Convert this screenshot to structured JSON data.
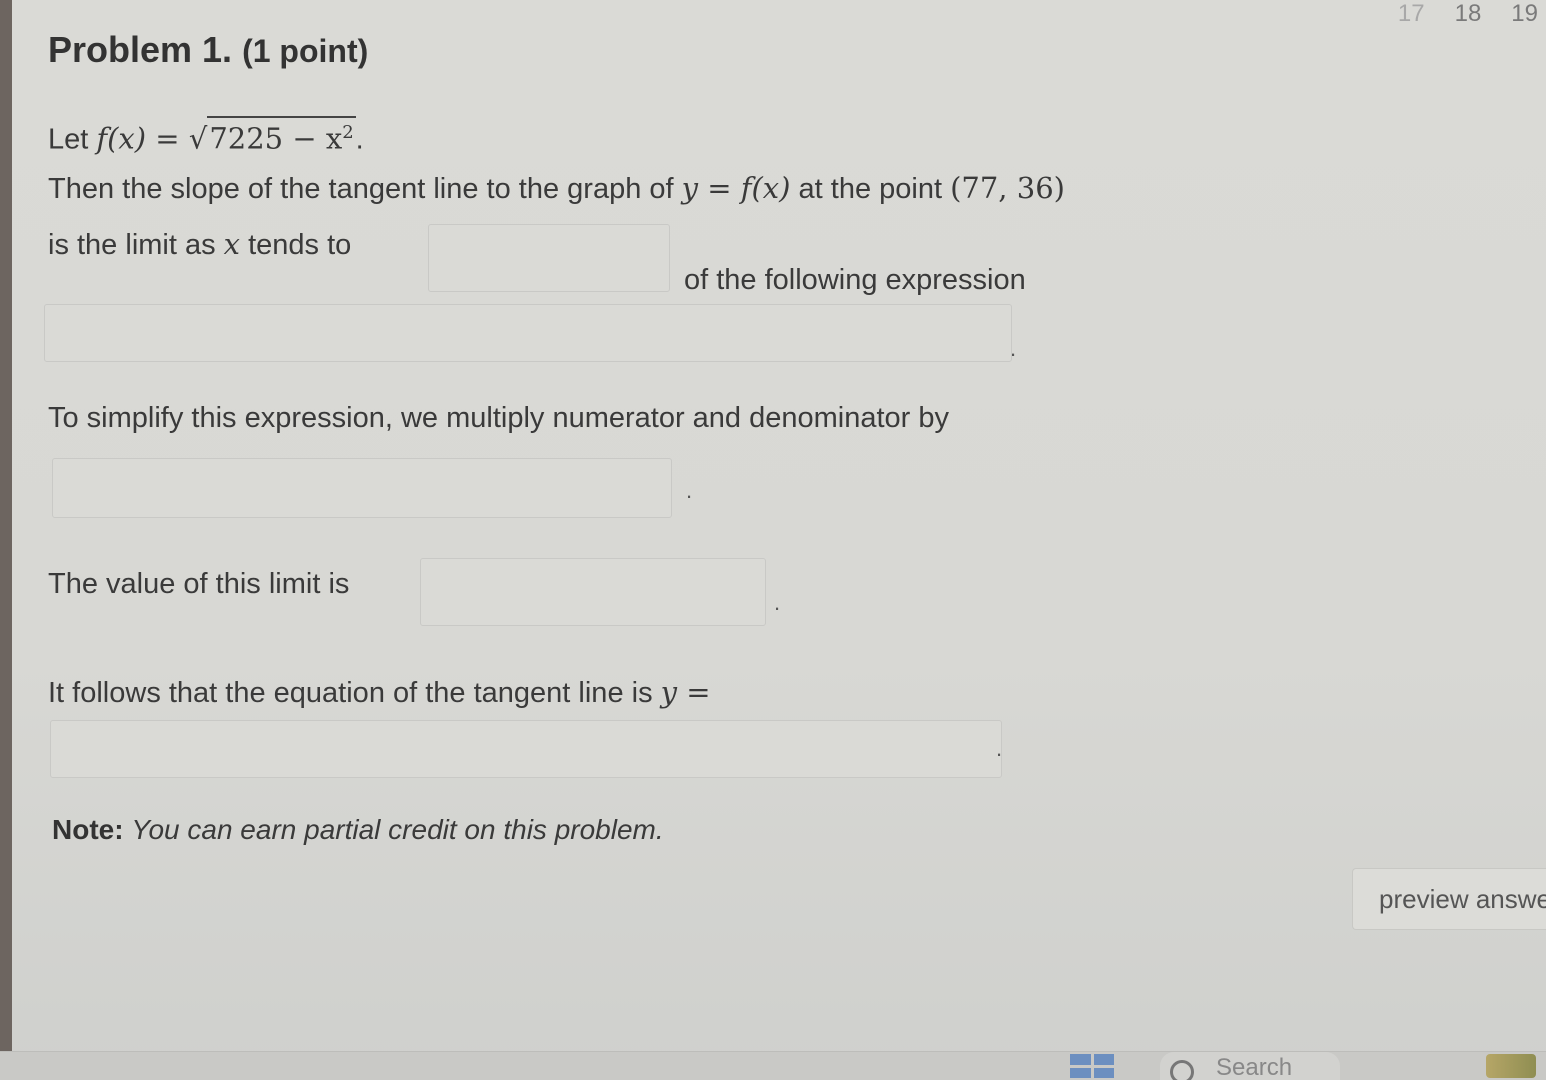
{
  "tabs": [
    {
      "label": "17",
      "faded": true
    },
    {
      "label": "18",
      "faded": false
    },
    {
      "label": "19",
      "faded": false
    }
  ],
  "problem": {
    "title": "Problem 1.",
    "points": "(1 point)",
    "let_prefix": "Let ",
    "function_def": "f(x) = ",
    "radicand": "7225 − x",
    "radicand_exp": "2",
    "period": ".",
    "line2_text": "Then the slope of the tangent line to the graph of ",
    "line2_math": "y = f(x)",
    "line2_text_b": " at the point ",
    "line2_point": "(77, 36)",
    "line3_a": "is the limit as ",
    "line3_var": "x",
    "line3_b": " tends to",
    "line3_c": "of the following expression",
    "simplify_text": "To simplify this expression, we multiply numerator and denominator by",
    "limit_value_text": "The value of this limit is",
    "tangent_text": "It follows that the equation of the tangent line is ",
    "tangent_math": "y =",
    "note_label": "Note:",
    "note_text": "You can earn partial credit on this problem."
  },
  "buttons": {
    "preview_label": "preview answe"
  },
  "taskbar": {
    "search_label": "Search"
  }
}
